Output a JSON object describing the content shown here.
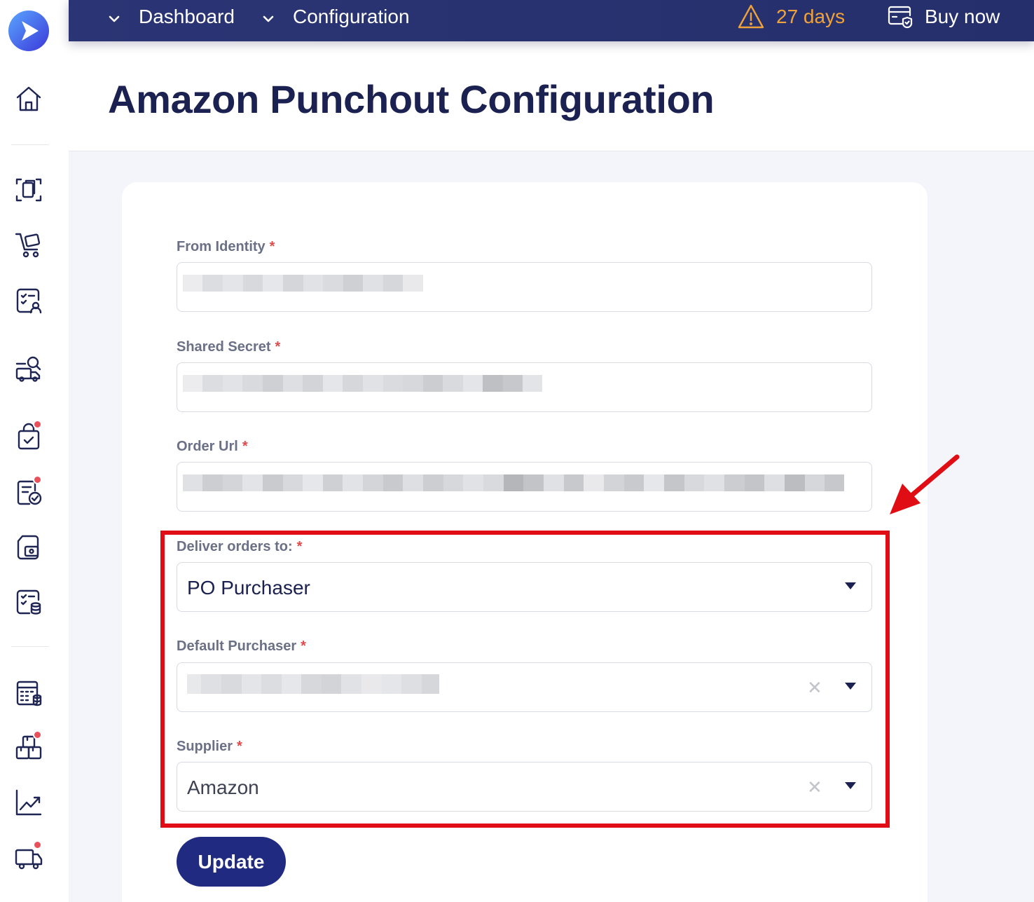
{
  "topbar": {
    "crumbs": [
      {
        "label": "Dashboard"
      },
      {
        "label": "Configuration"
      }
    ],
    "trial": {
      "label": "27 days",
      "icon": "warning-icon",
      "color": "#f0a23a"
    },
    "buy": {
      "label": "Buy now",
      "icon": "card-shield-icon"
    }
  },
  "sidebar": {
    "items": [
      {
        "name": "home-icon"
      },
      {
        "name": "scan-document-icon"
      },
      {
        "name": "cart-icon"
      },
      {
        "name": "approval-checklist-icon"
      },
      {
        "name": "supplier-search-icon"
      },
      {
        "name": "shopping-bag-check-icon",
        "badge": true
      },
      {
        "name": "document-check-icon",
        "badge": true
      },
      {
        "name": "receipt-box-icon"
      },
      {
        "name": "checklist-database-icon"
      },
      {
        "name": "budget-calculator-icon"
      },
      {
        "name": "inventory-boxes-icon",
        "badge": true
      },
      {
        "name": "analytics-chart-icon"
      },
      {
        "name": "delivery-truck-icon",
        "badge": true
      }
    ]
  },
  "page": {
    "title": "Amazon Punchout Configuration"
  },
  "form": {
    "from_identity": {
      "label": "From Identity",
      "required": "*"
    },
    "shared_secret": {
      "label": "Shared Secret",
      "required": "*"
    },
    "order_url": {
      "label": "Order Url",
      "required": "*"
    },
    "deliver_to": {
      "label": "Deliver orders to:",
      "required": "*",
      "value": "PO Purchaser"
    },
    "default_purchaser": {
      "label": "Default Purchaser",
      "required": "*"
    },
    "supplier": {
      "label": "Supplier",
      "required": "*",
      "value": "Amazon"
    },
    "update_label": "Update"
  },
  "colors": {
    "brand": "#1f2a80",
    "topbar": "#2b3575",
    "annotation": "#e10d14",
    "required": "#e14a4a"
  }
}
